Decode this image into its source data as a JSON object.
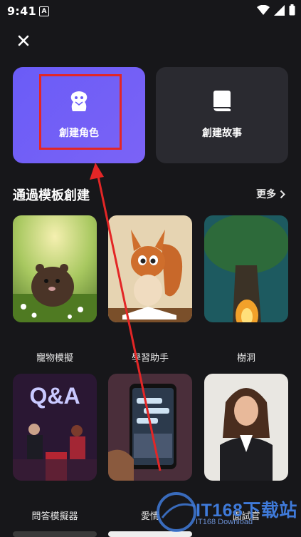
{
  "status_bar": {
    "time": "9:41",
    "notification_badge": "A"
  },
  "cards": {
    "role": {
      "label": "創建角色",
      "icon": "character-icon"
    },
    "story": {
      "label": "創建故事",
      "icon": "book-icon"
    }
  },
  "section": {
    "title": "通過模板創建",
    "more_label": "更多"
  },
  "templates": [
    {
      "label": "寵物模擬",
      "image": "hamster-image"
    },
    {
      "label": "學習助手",
      "image": "squirrel-image"
    },
    {
      "label": "樹洞",
      "image": "tree-image"
    },
    {
      "label": "問答模擬器",
      "image": "qa-show-image",
      "image_text": "Q&A"
    },
    {
      "label": "愛情",
      "image": "phone-chat-image"
    },
    {
      "label": "面試官",
      "image": "businesswoman-image"
    }
  ],
  "watermark": {
    "text": "IT168下载站",
    "subtext": "IT168 Download"
  },
  "colors": {
    "background": "#17171a",
    "accent": "#6a5cf7",
    "card_dark": "#2a2a30",
    "annotation_red": "#e32626"
  }
}
